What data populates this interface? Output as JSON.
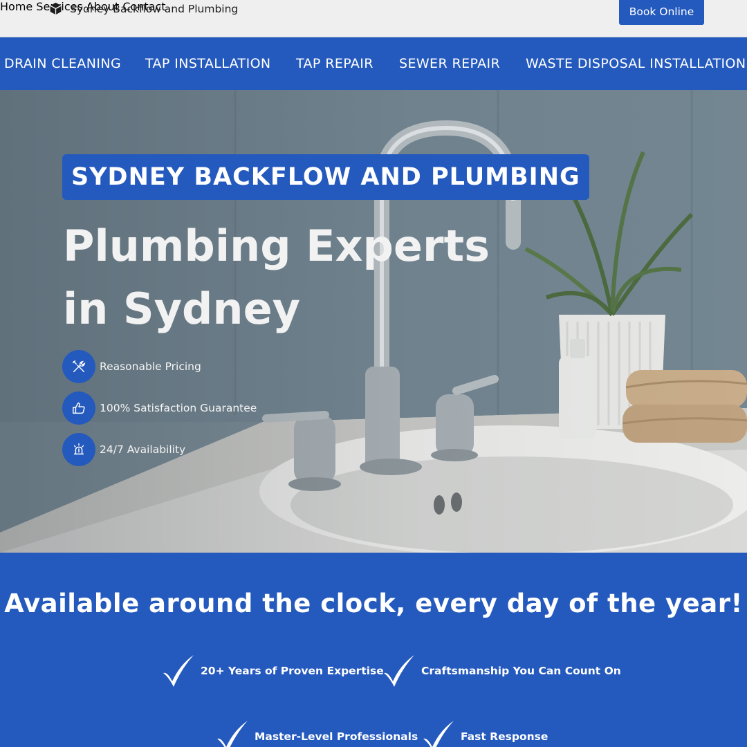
{
  "header": {
    "brand_name": "Sydney Backflow and Plumbing",
    "brand_icon": "cube-icon",
    "nav": [
      "Home",
      "Services",
      "About",
      "Contact"
    ],
    "cta_label": "Book Online"
  },
  "services_strip": [
    "DRAIN CLEANING",
    "TAP INSTALLATION",
    "TAP REPAIR",
    "SEWER REPAIR",
    "WASTE DISPOSAL INSTALLATION"
  ],
  "hero": {
    "badge": "SYDNEY BACKFLOW AND PLUMBING",
    "title_line1": "Plumbing Experts",
    "title_line2": "in Sydney",
    "features": [
      {
        "label": "Reasonable Pricing",
        "icon": "tools-icon"
      },
      {
        "label": "100% Satisfaction Guarantee",
        "icon": "thumbs-up-icon"
      },
      {
        "label": "24/7 Availability",
        "icon": "siren-icon"
      }
    ]
  },
  "availability": {
    "heading": "Available around the clock, every day of the year!",
    "points": [
      "20+ Years of Proven Expertise",
      "Craftsmanship You Can Count On",
      "Master-Level Professionals",
      "Fast Response"
    ],
    "icon": "checkmark-icon"
  },
  "colors": {
    "brand_blue": "#2459bd",
    "header_bg": "#efefef",
    "nav_text": "#7a7a7a"
  }
}
